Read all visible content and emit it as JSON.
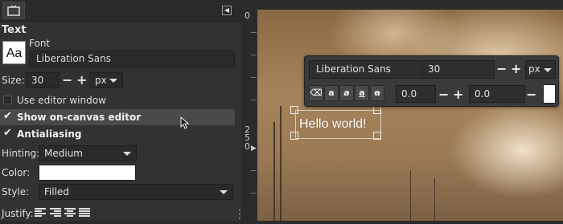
{
  "panel": {
    "title": "Text",
    "font_preview": "Aa",
    "font_label": "Font",
    "font_value": "Liberation Sans",
    "size_label": "Size:",
    "size_value": "30",
    "size_plus": "+",
    "size_minus": "−",
    "unit": "px",
    "use_editor_label": "Use editor window",
    "show_canvas_editor_label": "Show on-canvas editor",
    "antialiasing_label": "Antialiasing",
    "hinting_label": "Hinting:",
    "hinting_value": "Medium",
    "color_label": "Color:",
    "color_value": "#ffffff",
    "style_label": "Style:",
    "style_value": "Filled",
    "justify_label": "Justify:"
  },
  "ruler": {
    "top_zero": "0",
    "mark_250": [
      "2",
      "5",
      "0"
    ]
  },
  "toolbar": {
    "font": "Liberation Sans",
    "size": "30",
    "unit": "px",
    "baseline": "0.0",
    "kerning": "0.0",
    "plus": "+",
    "minus": "−"
  },
  "canvas": {
    "text": "Hello world!"
  },
  "icons": [
    "tool-options-icon",
    "panel-menu-icon",
    "mouse-cursor-icon",
    "clear-style-icon",
    "bold-icon",
    "italic-icon",
    "underline-icon",
    "strikethrough-icon",
    "justify-left-icon",
    "justify-right-icon",
    "justify-center-icon",
    "justify-fill-icon"
  ]
}
